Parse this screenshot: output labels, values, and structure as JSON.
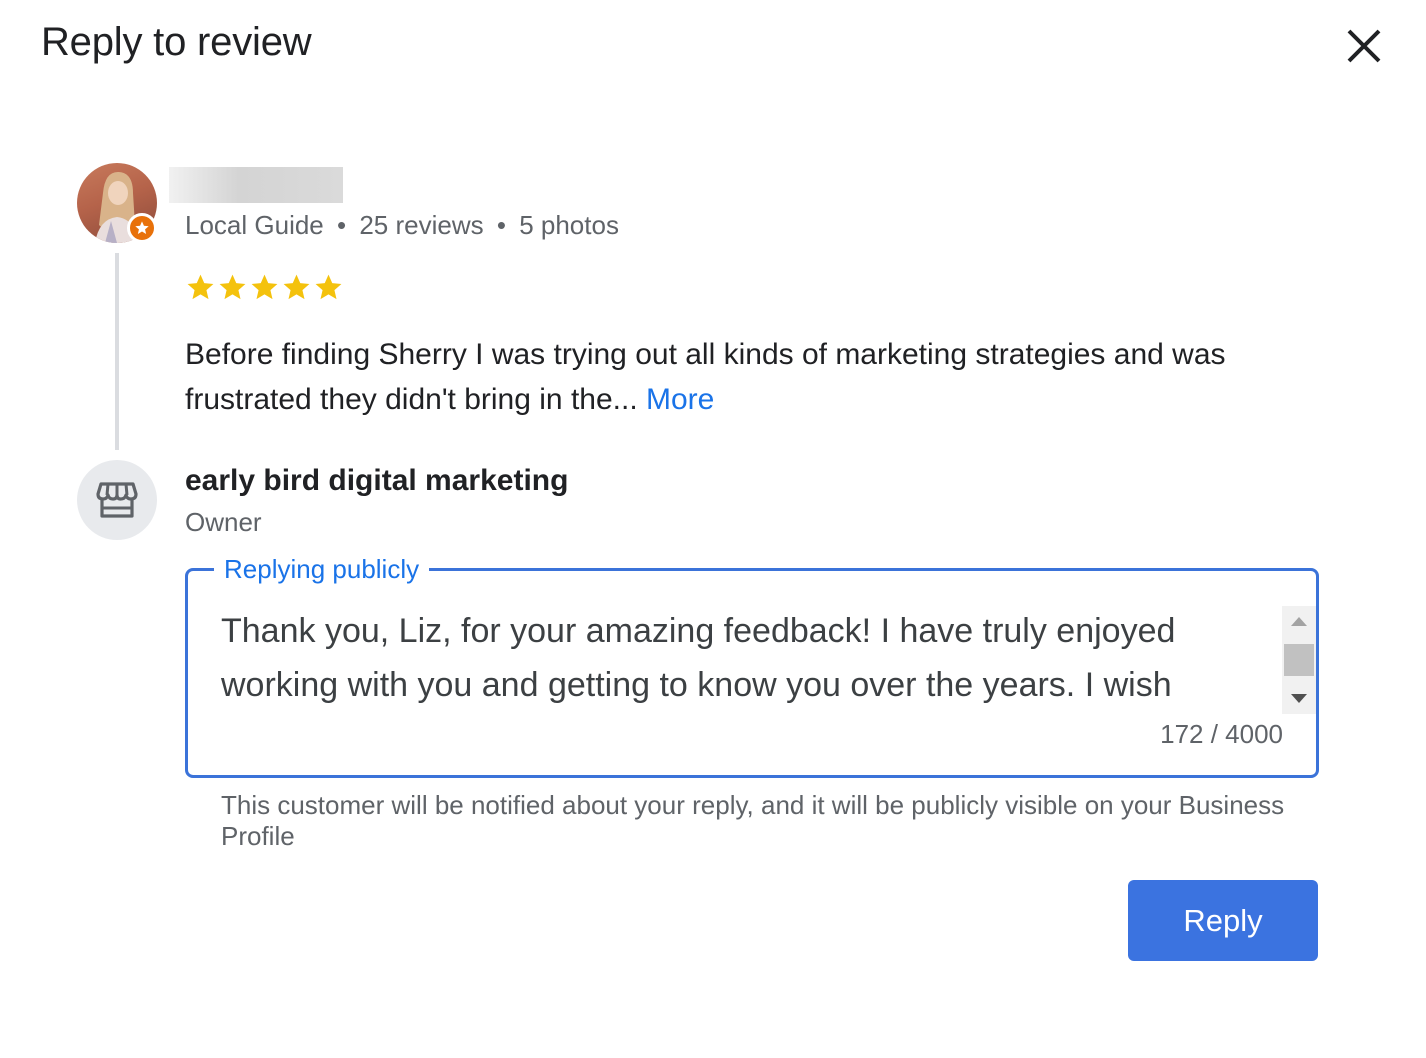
{
  "dialog": {
    "title": "Reply to review",
    "close_icon": "close-icon"
  },
  "reviewer": {
    "badge_icon": "local-guide-star-icon",
    "meta": {
      "level": "Local Guide",
      "reviews": "25 reviews",
      "photos": "5 photos",
      "separator": "•"
    },
    "rating": 5,
    "star_color": "#f4c20d",
    "review_text": "Before finding Sherry I was trying out all kinds of marketing strategies and was frustrated they didn't bring in the...",
    "more_label": "More"
  },
  "owner": {
    "icon": "storefront-icon",
    "name": "early bird digital marketing",
    "role": "Owner"
  },
  "reply": {
    "legend": "Replying publicly",
    "text": "Thank you, Liz, for your amazing feedback! I have truly enjoyed working with you and getting to know you over the years. I wish",
    "char_count": "172 / 4000",
    "helper": "This customer will be notified about your reply, and it will be publicly visible on your Business Profile",
    "button_label": "Reply",
    "accent": "#3b73e0"
  }
}
